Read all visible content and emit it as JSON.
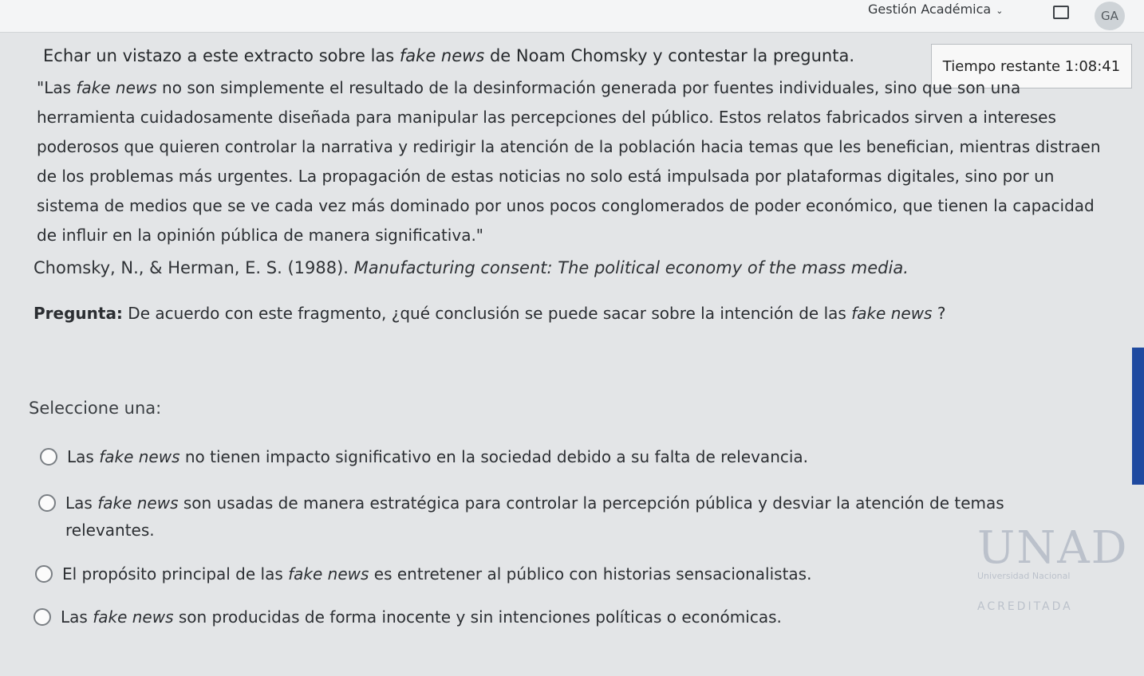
{
  "topbar": {
    "nav_label": "Gestión Académica",
    "avatar_initials": "GA"
  },
  "timer": {
    "label": "Tiempo restante 1:08:41"
  },
  "question": {
    "intro_pre": "Echar un vistazo a este extracto sobre las ",
    "intro_italic": "fake news",
    "intro_post": " de Noam Chomsky y contestar la pregunta.",
    "quote_pre": "\"Las ",
    "quote_italic": "fake news",
    "quote_post": " no son simplemente el resultado de la desinformación generada por fuentes individuales, sino que son una herramienta cuidadosamente diseñada para manipular las percepciones del público. Estos relatos fabricados sirven a intereses poderosos que quieren controlar la narrativa y redirigir la atención de la población hacia temas que les benefician, mientras distraen de los problemas más urgentes. La propagación de estas noticias no solo está impulsada por plataformas digitales, sino por un sistema de medios que se ve cada vez más dominado por unos pocos conglomerados de poder económico, que tienen la capacidad de influir en la opinión pública de manera significativa.\"",
    "citation_pre": "Chomsky, N., & Herman, E. S. (1988). ",
    "citation_italic": "Manufacturing consent: The political economy of the mass media.",
    "prompt_bold": "Pregunta:",
    "prompt_pre": " De acuerdo con este fragmento, ¿qué conclusión se puede sacar sobre la intención de las ",
    "prompt_italic": "fake news",
    "prompt_post": " ?",
    "select_label": "Seleccione una:"
  },
  "options": [
    {
      "pre": "Las ",
      "italic": "fake news",
      "post": " no tienen impacto significativo en la sociedad debido a su falta de relevancia."
    },
    {
      "pre": "Las ",
      "italic": "fake news",
      "post": " son usadas de manera estratégica para controlar la percepción pública y desviar la atención de temas relevantes."
    },
    {
      "pre": "El propósito principal de las ",
      "italic": "fake news",
      "post": " es entretener al público con historias sensacionalistas."
    },
    {
      "pre": "Las ",
      "italic": "fake news",
      "post": " son producidas de forma inocente y sin intenciones políticas o económicas."
    }
  ],
  "logo": {
    "mark": "UNAD",
    "subtitle": "Universidad Nacional",
    "accredited": "ACREDITADA"
  },
  "colors": {
    "accent_scrollbar": "#1f4aa0"
  }
}
